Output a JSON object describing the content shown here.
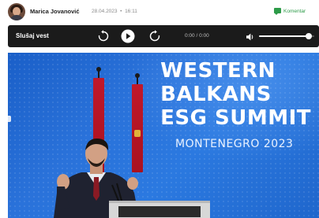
{
  "byline": {
    "author": "Marica Jovanović",
    "date": "28.04.2023",
    "time": "16:11",
    "comments_label": "Komentar"
  },
  "player": {
    "title": "Slušaj vest",
    "time_display": "0:00 / 0:00",
    "volume_level": 0.9,
    "icons": {
      "rewind": "rewind-icon",
      "play": "play-icon",
      "forward": "forward-icon",
      "volume": "volume-icon"
    }
  },
  "photo": {
    "banner_lines": [
      "WESTERN",
      "BALKANS",
      "ESG SUMMIT"
    ],
    "banner_subtitle": "MONTENEGRO 2023"
  },
  "colors": {
    "player_bg": "#1b1b1b",
    "comment_accent": "#2d9b49",
    "stage_blue": "#2b79e0",
    "flag_red": "#c0182a"
  }
}
